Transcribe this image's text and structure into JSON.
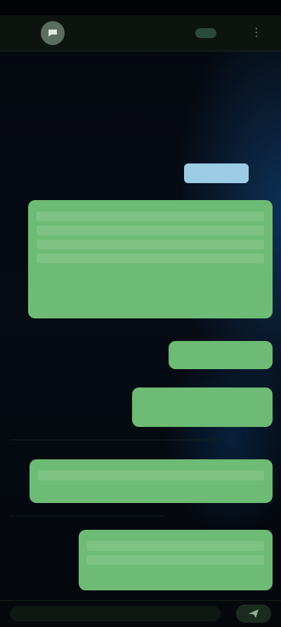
{
  "status_bar": {
    "time": "",
    "indicators": ""
  },
  "app_bar": {
    "title": "",
    "icon": "app-icon",
    "menu_icon": "more-icon"
  },
  "chat": {
    "chip_label": "",
    "labels": [
      "",
      "",
      "",
      ""
    ],
    "bubbles": [
      {
        "text": ""
      },
      {
        "text": ""
      },
      {
        "text": ""
      },
      {
        "text": ""
      },
      {
        "text": ""
      }
    ]
  },
  "input": {
    "placeholder": "",
    "send_icon": "send-icon"
  },
  "colors": {
    "bubble": "#6dbb74",
    "chip": "#9ccbe4",
    "background": "#04070d",
    "app_bar": "#0d1410"
  }
}
